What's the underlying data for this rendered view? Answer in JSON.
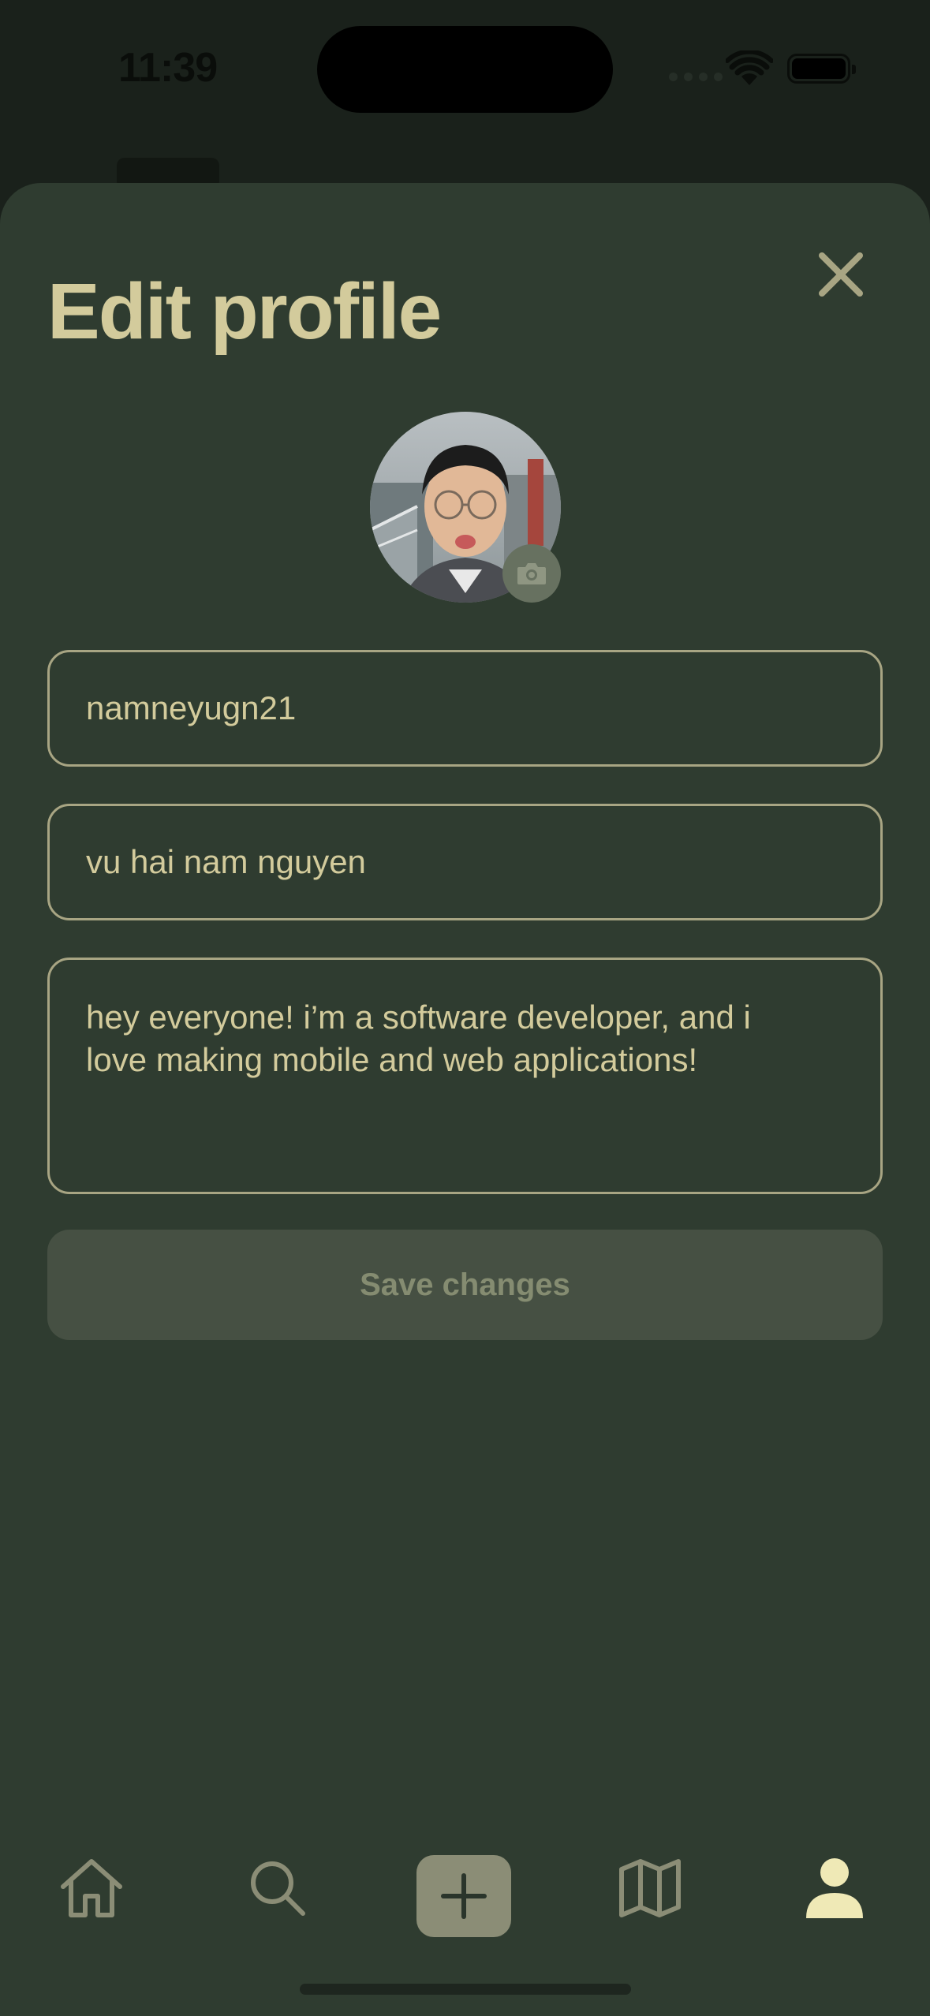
{
  "status_bar": {
    "time": "11:39"
  },
  "sheet": {
    "title": "Edit profile",
    "close_icon": "close-icon",
    "avatar_badge_icon": "camera-icon"
  },
  "form": {
    "username": "namneyugn21",
    "display_name": "vu hai nam nguyen",
    "bio_line1": "hey everyone! i’m a software developer, and i",
    "bio_line2": "love making mobile and web applications!",
    "save_label": "Save changes"
  },
  "tab_bar": {
    "items": [
      "home-icon",
      "search-icon",
      "plus-icon",
      "map-icon",
      "profile-icon"
    ],
    "active": "profile-icon"
  },
  "colors": {
    "accent_text": "#d3cb9c",
    "sheet_bg": "#2f3c30",
    "field_border": "#a8a583",
    "button_disabled_bg": "#465043",
    "button_disabled_text": "#858c71"
  }
}
